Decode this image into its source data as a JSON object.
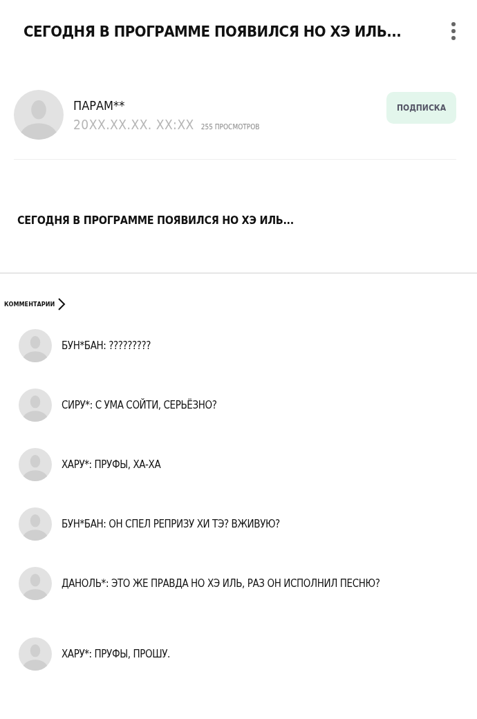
{
  "header": {
    "title": "СЕГОДНЯ В ПРОГРАММЕ ПОЯВИЛСЯ НО ХЭ ИЛЬ..."
  },
  "post": {
    "author": "ПАРАМ**",
    "date": "20XX.XX.XX. XX:XX",
    "views": "255 ПРОСМОТРОВ",
    "subscribe": "ПОДПИСКА",
    "text": "СЕГОДНЯ В ПРОГРАММЕ ПОЯВИЛСЯ НО ХЭ ИЛЬ..."
  },
  "comments_link": "КОММЕНТАРИИ",
  "comments": [
    {
      "text": "БУН*БАН: ?????????"
    },
    {
      "text": "СИРУ*: С УМА СОЙТИ, СЕРЬЁЗНО?"
    },
    {
      "text": "ХАРУ*: ПРУФЫ, ХА-ХА"
    },
    {
      "text": "БУН*БАН: ОН СПЕЛ РЕПРИЗУ ХИ ТЭ? ВЖИВУЮ?"
    },
    {
      "text": "ДАНОЛЬ*: ЭТО ЖЕ ПРАВДА НО ХЭ ИЛЬ, РАЗ ОН ИСПОЛНИЛ ПЕСНЮ?"
    },
    {
      "text": "ХАРУ*: ПРУФЫ, ПРОШУ."
    }
  ]
}
